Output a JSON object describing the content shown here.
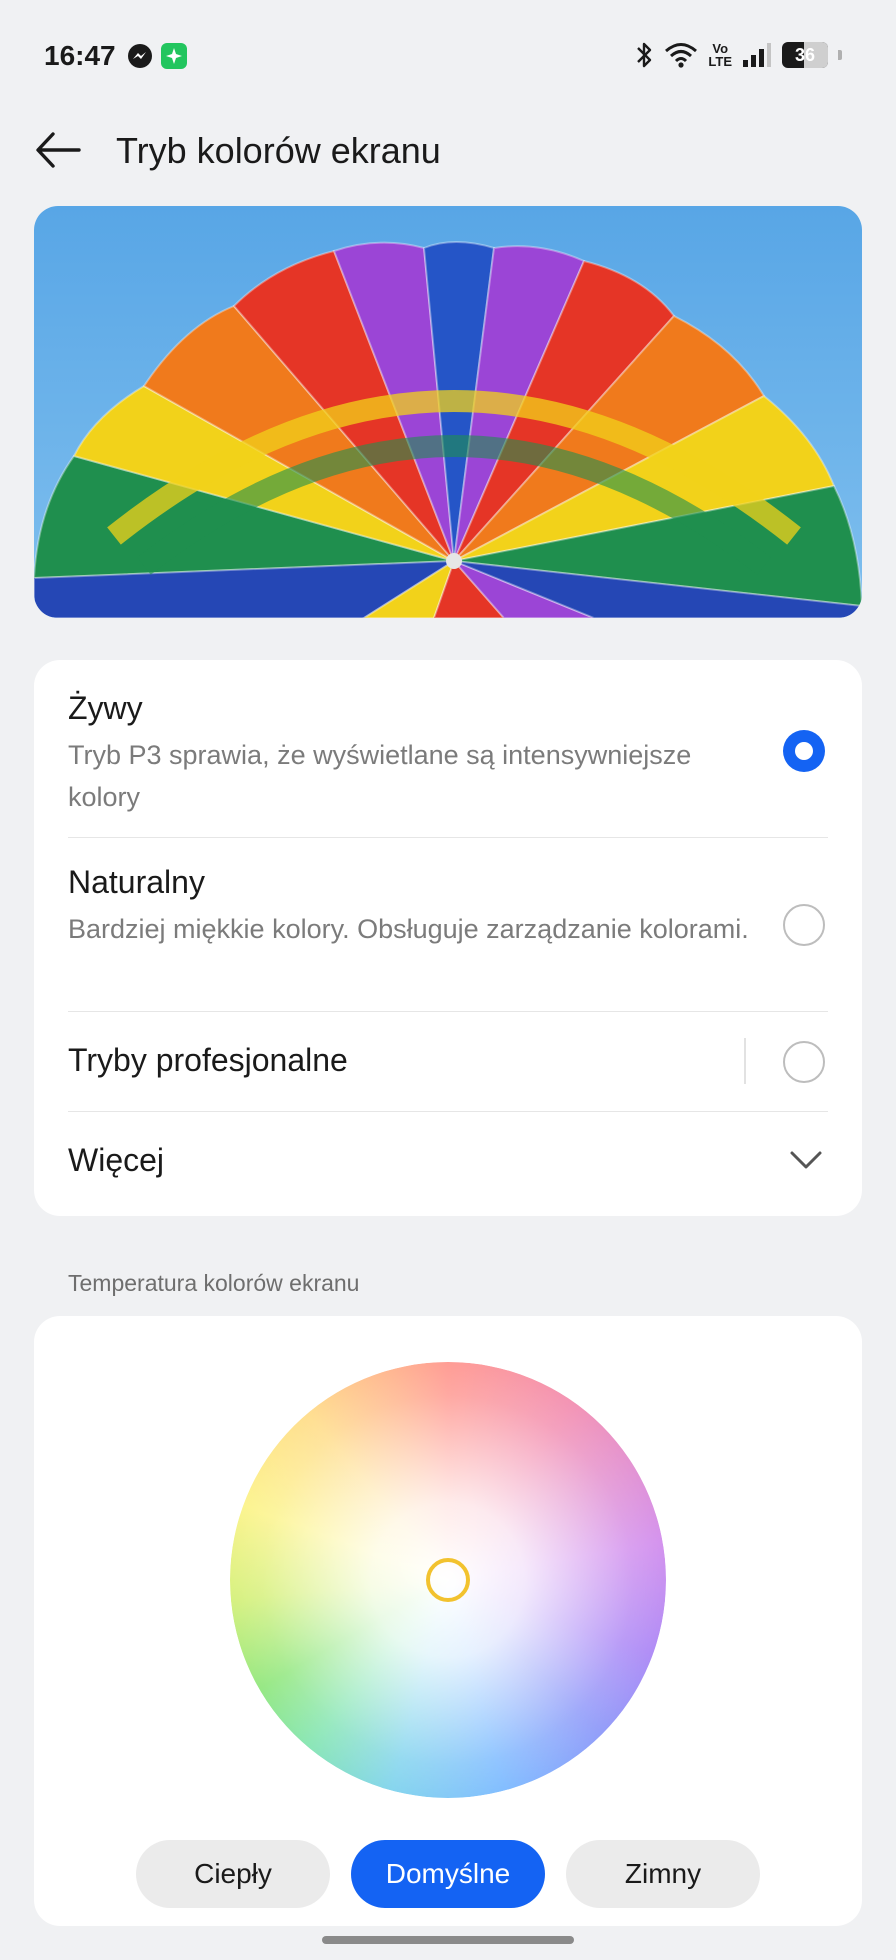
{
  "status_bar": {
    "time": "16:47",
    "app_icons": [
      "messenger-icon",
      "green-app-icon"
    ],
    "network_label_top": "Vo",
    "network_label_bottom": "LTE",
    "battery_level": "36"
  },
  "header": {
    "title": "Tryb kolorów ekranu",
    "back_icon": "arrow-left-icon"
  },
  "preview": {
    "subject": "parachute-image"
  },
  "modes": {
    "items": [
      {
        "title": "Żywy",
        "description": "Tryb P3 sprawia, że wyświetlane są intensywniejsze kolory",
        "selected": true
      },
      {
        "title": "Naturalny",
        "description": "Bardziej miękkie kolory. Obsługuje zarządzanie kolorami.",
        "selected": false
      },
      {
        "title": "Tryby profesjonalne",
        "selected": false
      }
    ],
    "more_label": "Więcej"
  },
  "temperature": {
    "section_label": "Temperatura kolorów ekranu",
    "presets": [
      "Ciepły",
      "Domyślne",
      "Zimny"
    ],
    "active_preset": "Domyślne"
  },
  "colors": {
    "accent": "#1463f3",
    "background": "#f0f1f3",
    "card": "#ffffff",
    "handle": "#f2c22e"
  }
}
